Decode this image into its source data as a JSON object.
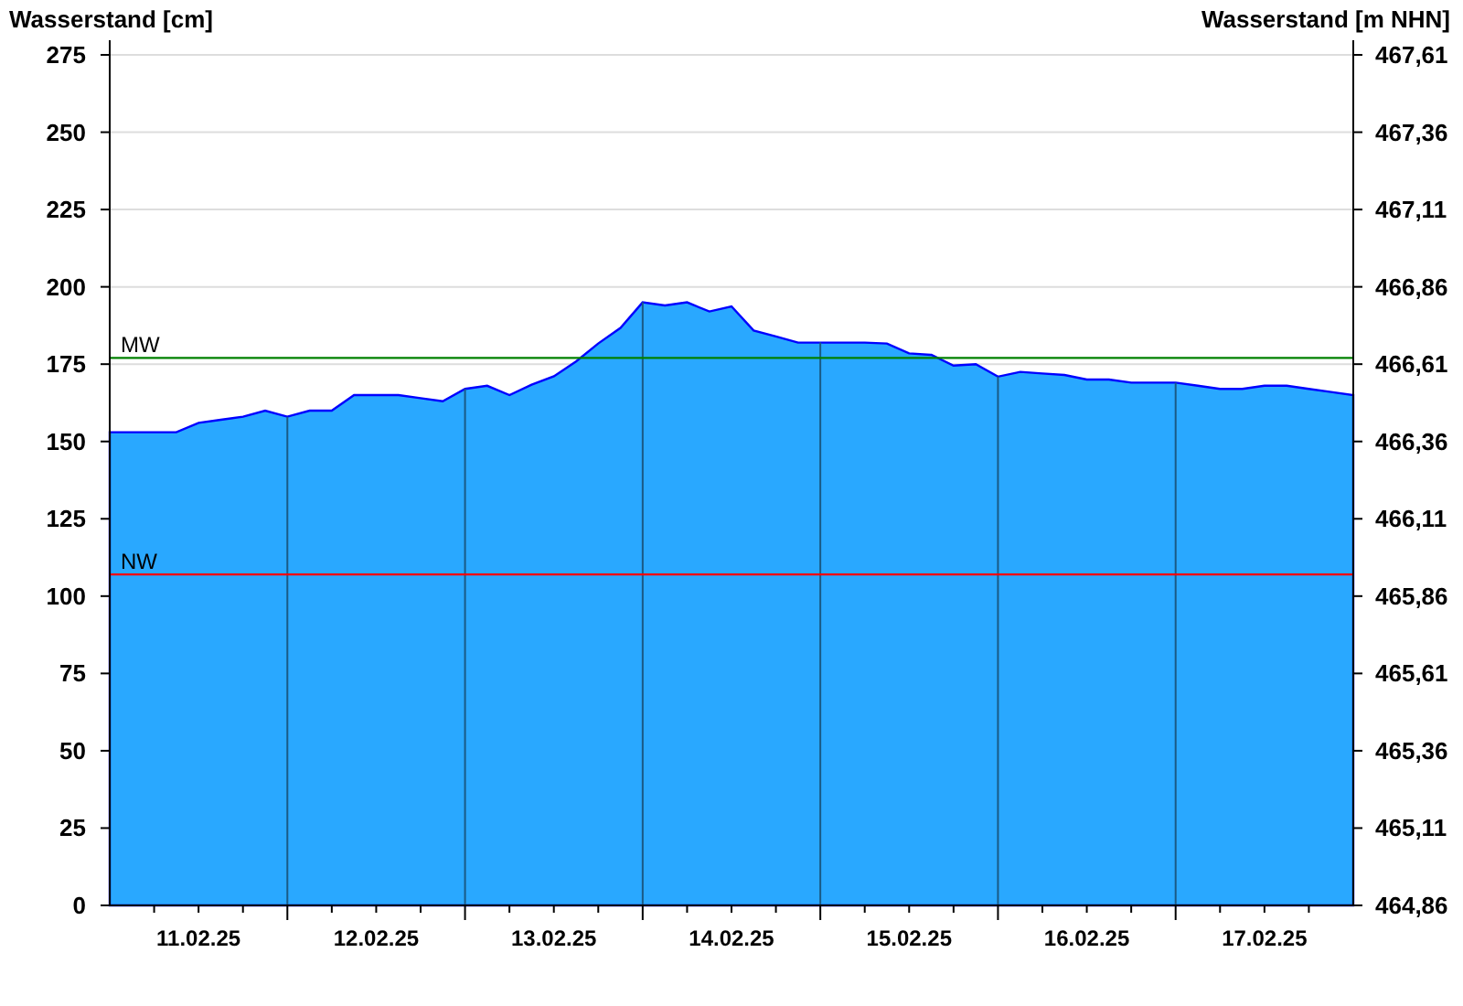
{
  "chart": {
    "chart_data": {
      "type": "area",
      "ylabel": "Wasserstand [cm]",
      "categories": [
        null,
        null,
        null,
        null,
        "11.02.25",
        null,
        null,
        null,
        null,
        null,
        null,
        null,
        "12.02.25",
        null,
        null,
        null,
        null,
        null,
        null,
        null,
        "13.02.25",
        null,
        null,
        null,
        null,
        null,
        null,
        null,
        "14.02.25",
        null,
        null,
        null,
        null,
        null,
        null,
        null,
        "15.02.25",
        null,
        null,
        null,
        null,
        null,
        null,
        null,
        "16.02.25",
        null,
        null,
        null,
        null,
        null,
        null,
        null,
        "17.02.25",
        null,
        null,
        null,
        null
      ],
      "grid": true,
      "series": [
        {
          "color": "#29a8ff",
          "values": [
            153,
            153,
            153,
            153,
            156,
            157,
            158,
            160,
            158,
            160,
            160,
            165,
            165,
            165,
            164,
            163,
            167,
            168,
            165,
            168.4,
            171.1,
            175.9,
            181.7,
            186.7,
            195,
            194,
            195,
            192,
            193.7,
            185.9,
            184,
            182,
            182,
            182,
            182,
            181.7,
            178.5,
            178,
            174.5,
            175,
            171,
            172.5,
            172,
            171.5,
            170,
            170,
            169,
            169,
            169,
            168,
            167,
            167,
            168,
            168,
            167,
            166,
            165
          ]
        }
      ],
      "ylim": [
        0,
        275
      ],
      "yticks": [
        0,
        25,
        50,
        75,
        100,
        125,
        150,
        175,
        200,
        225,
        250,
        275
      ],
      "ref_lines": [
        {
          "axis": "y",
          "value": 177,
          "label": "MW",
          "color": "#008000"
        },
        {
          "axis": "y",
          "value": 107,
          "label": "NW",
          "color": "#ff0000"
        }
      ]
    },
    "right_axis": {
      "title": "Wasserstand [m NHN]",
      "tick_labels": [
        "467,61",
        "467,36",
        "467,11",
        "466,86",
        "466,61",
        "466,36",
        "466,11",
        "465,86",
        "465,61",
        "465,36",
        "465,11",
        "464,86"
      ]
    }
  }
}
